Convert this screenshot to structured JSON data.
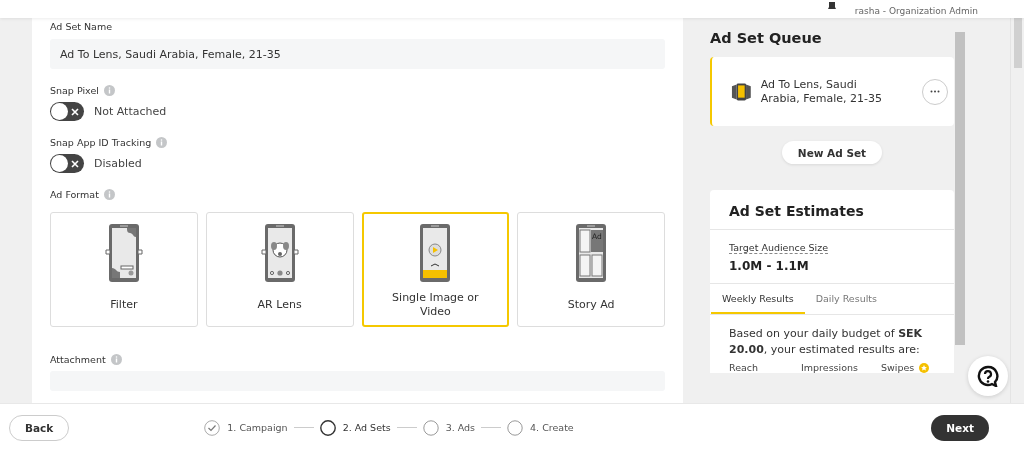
{
  "header": {
    "user": "rasha - Organization Admin"
  },
  "form": {
    "ad_set_name": {
      "label": "Ad Set Name",
      "value": "Ad To Lens, Saudi Arabia, Female, 21-35"
    },
    "toggles": [
      {
        "label": "Snap Pixel",
        "on": false,
        "state_text": "Not Attached"
      },
      {
        "label": "Snap App ID Tracking",
        "on": false,
        "state_text": "Disabled"
      }
    ],
    "ad_format": {
      "label": "Ad Format",
      "options": [
        {
          "label": "Filter",
          "kind": "filter",
          "selected": false
        },
        {
          "label": "AR Lens",
          "kind": "lens",
          "selected": false
        },
        {
          "label": "Single Image or Video",
          "kind": "single",
          "selected": true
        },
        {
          "label": "Story Ad",
          "kind": "story",
          "selected": false,
          "tag": "Ad"
        }
      ]
    },
    "attachment": {
      "label": "Attachment"
    }
  },
  "queue": {
    "title": "Ad Set Queue",
    "items": [
      {
        "name": "Ad To Lens, Saudi Arabia, Female, 21-35",
        "selected": true
      }
    ],
    "new_button": "New Ad Set"
  },
  "estimates": {
    "title": "Ad Set Estimates",
    "audience_label": "Target Audience Size",
    "audience_value": "1.0M - 1.1M",
    "tabs": [
      {
        "label": "Weekly Results",
        "selected": true
      },
      {
        "label": "Daily Results",
        "selected": false
      }
    ],
    "summary": "Based on your daily budget of **SEK 20.00**, your estimated results are:",
    "columns": [
      "Reach",
      "Impressions",
      "Swipes"
    ]
  },
  "footer": {
    "back": "Back",
    "steps": [
      {
        "label": "1. Campaign",
        "completed": true,
        "selected": false
      },
      {
        "label": "2. Ad Sets",
        "completed": false,
        "selected": true
      },
      {
        "label": "3. Ads",
        "completed": false,
        "selected": false
      },
      {
        "label": "4. Create",
        "completed": false,
        "selected": false
      }
    ],
    "next": "Next"
  }
}
